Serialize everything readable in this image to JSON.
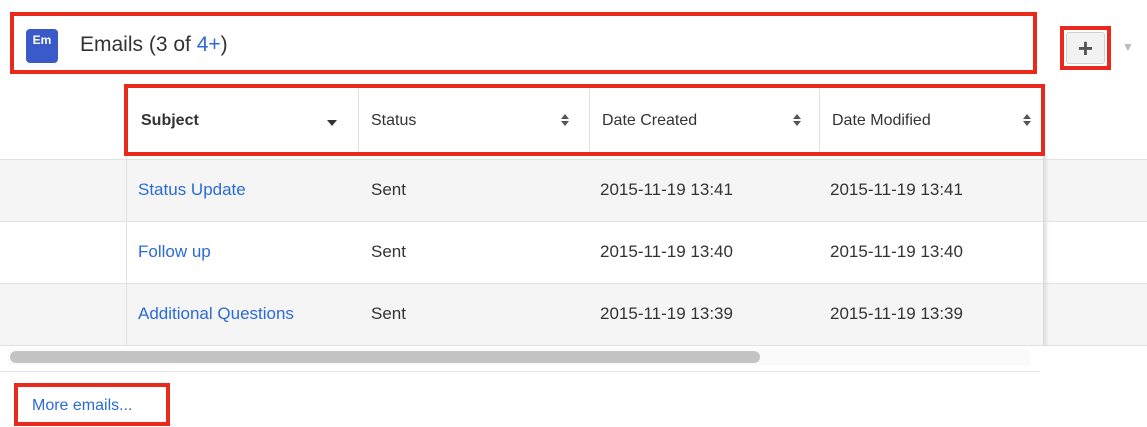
{
  "subpanel": {
    "module_badge": "Em",
    "title_prefix": "Emails (3 of ",
    "count_link": "4+",
    "title_suffix": ")",
    "create_label": "+",
    "actions_caret": "▼"
  },
  "table": {
    "columns": [
      {
        "label": "Subject",
        "sort_icon": "caret-down-icon",
        "active": true
      },
      {
        "label": "Status",
        "sort_icon": "sort-both-icon"
      },
      {
        "label": "Date Created",
        "sort_icon": "sort-both-icon"
      },
      {
        "label": "Date Modified",
        "sort_icon": "sort-both-icon"
      }
    ],
    "rows": [
      {
        "subject": "Status Update",
        "status": "Sent",
        "date_created": "2015-11-19 13:41",
        "date_modified": "2015-11-19 13:41"
      },
      {
        "subject": "Follow up",
        "status": "Sent",
        "date_created": "2015-11-19 13:40",
        "date_modified": "2015-11-19 13:40"
      },
      {
        "subject": "Additional Questions",
        "status": "Sent",
        "date_created": "2015-11-19 13:39",
        "date_modified": "2015-11-19 13:39"
      }
    ]
  },
  "footer": {
    "more_link": "More emails..."
  },
  "colors": {
    "highlight": "#e8291c",
    "link": "#2b6bd6",
    "badge": "#3b5aca",
    "row_alt": "#f5f5f5"
  }
}
